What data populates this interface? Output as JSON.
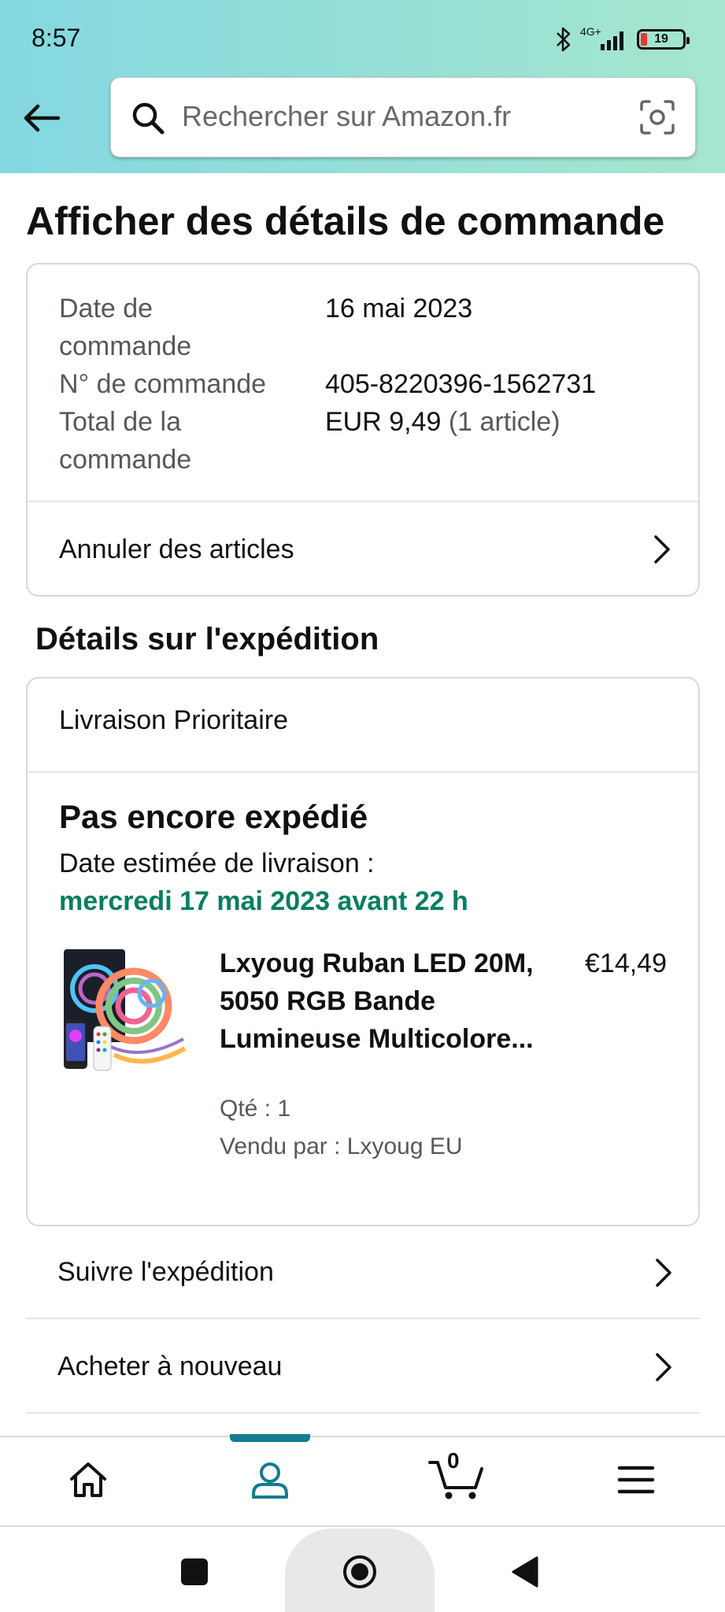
{
  "status_bar": {
    "time": "8:57",
    "network": "4G+",
    "battery": "19"
  },
  "search": {
    "placeholder": "Rechercher sur Amazon.fr"
  },
  "page": {
    "title": "Afficher des détails de commande"
  },
  "order": {
    "date_label": "Date de commande",
    "date_value": "16 mai 2023",
    "number_label": "N° de commande",
    "number_value": "405-8220396-1562731",
    "total_label": "Total de la commande",
    "total_value": "EUR 9,49",
    "total_items": "(1 article)",
    "cancel_label": "Annuler des articles"
  },
  "shipment": {
    "section_title": "Détails sur l'expédition",
    "speed": "Livraison Prioritaire",
    "status": "Pas encore expédié",
    "estimate_label": "Date estimée de livraison :",
    "estimate_date": "mercredi 17 mai 2023 avant 22 h",
    "product": {
      "title": "Lxyoug Ruban LED 20M, 5050 RGB Bande Lumineuse Multicolore...",
      "price": "€14,49",
      "quantity": "Qté : 1",
      "seller": "Vendu par : Lxyoug EU"
    }
  },
  "actions": {
    "track": "Suivre l'expédition",
    "buy_again": "Acheter à nouveau"
  },
  "bottom_nav": {
    "items": [
      "home-icon",
      "account-icon",
      "cart-icon",
      "menu-icon"
    ],
    "active": "account-icon",
    "cart_count": "0"
  },
  "colors": {
    "accent": "#137c8f",
    "delivery_green": "#067d62"
  }
}
